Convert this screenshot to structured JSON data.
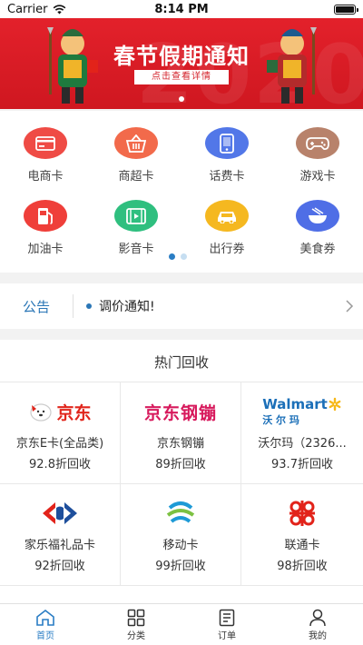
{
  "status": {
    "carrier": "Carrier",
    "time": "8:14 PM"
  },
  "banner": {
    "title": "春节假期通知",
    "subtitle": "点击查看详情",
    "bg_year": "2020"
  },
  "categories": [
    {
      "label": "电商卡",
      "icon": "card-icon",
      "color": "#ef4b45"
    },
    {
      "label": "商超卡",
      "icon": "basket-icon",
      "color": "#f26a4b"
    },
    {
      "label": "话费卡",
      "icon": "phone-icon",
      "color": "#5277e8"
    },
    {
      "label": "游戏卡",
      "icon": "gamepad-icon",
      "color": "#b8826b"
    },
    {
      "label": "加油卡",
      "icon": "fuel-icon",
      "color": "#ef3f3a"
    },
    {
      "label": "影音卡",
      "icon": "film-icon",
      "color": "#2fbf7f"
    },
    {
      "label": "出行券",
      "icon": "car-icon",
      "color": "#f5b820"
    },
    {
      "label": "美食券",
      "icon": "bowl-icon",
      "color": "#4f6ee6"
    }
  ],
  "notice": {
    "tag": "公告",
    "text": "调价通知!"
  },
  "hot": {
    "title": "热门回收",
    "cards": [
      {
        "name": "京东E卡(全品类)",
        "rate": "92.8折回收",
        "logo": "京东",
        "logo_color": "#e1251b"
      },
      {
        "name": "京东钢镚",
        "rate": "89折回收",
        "logo": "京东钢镚",
        "logo_color": "#d7195c"
      },
      {
        "name": "沃尔玛（2326...",
        "rate": "93.7折回收",
        "logo": "Walmart",
        "logo_sub": "沃 尔 玛",
        "logo_color": "#1b6fb8"
      },
      {
        "name": "家乐福礼品卡",
        "rate": "92折回收",
        "logo": "carrefour",
        "logo_color": "#1e4f9c"
      },
      {
        "name": "移动卡",
        "rate": "99折回收",
        "logo": "china-mobile",
        "logo_color": "#1e9ad6"
      },
      {
        "name": "联通卡",
        "rate": "98折回收",
        "logo": "china-unicom",
        "logo_color": "#e2231a"
      }
    ]
  },
  "tabs": [
    {
      "label": "首页",
      "icon": "home-icon",
      "active": true
    },
    {
      "label": "分类",
      "icon": "grid-icon",
      "active": false
    },
    {
      "label": "订单",
      "icon": "order-icon",
      "active": false
    },
    {
      "label": "我的",
      "icon": "user-icon",
      "active": false
    }
  ]
}
